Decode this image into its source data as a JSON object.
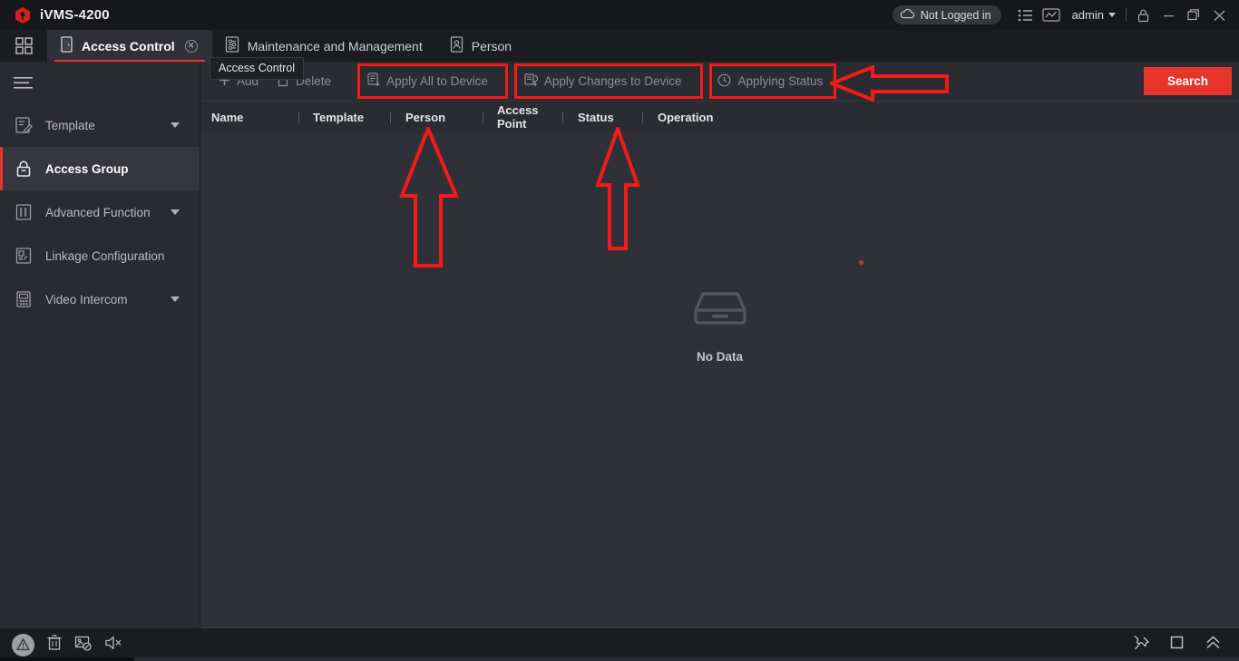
{
  "window": {
    "app_title": "iVMS-4200",
    "logo_icon": "hik-shield-icon",
    "login_status": "Not Logged in",
    "login_status_icon": "cloud-icon",
    "list_icon": "list-icon",
    "chart_icon": "chart-icon",
    "user_name": "admin",
    "user_caret_icon": "chevron-down-icon",
    "lock_icon": "lock-icon",
    "minimize_icon": "minimize-icon",
    "maximize_icon": "maximize-icon",
    "close_icon": "close-icon"
  },
  "tabbar": {
    "grid_icon": "grid-apps-icon",
    "tabs": [
      {
        "label": "Access Control",
        "icon": "door-icon",
        "active": true,
        "closable": true,
        "close_icon": "close-circle-icon"
      },
      {
        "label": "Maintenance and Management",
        "icon": "maintenance-icon",
        "active": false,
        "closable": false
      },
      {
        "label": "Person",
        "icon": "person-card-icon",
        "active": false,
        "closable": false
      }
    ]
  },
  "tooltip": {
    "text": "Access Control"
  },
  "sidebar": {
    "menu_icon": "hamburger-icon",
    "items": [
      {
        "label": "Template",
        "icon": "template-icon",
        "expandable": true,
        "active": false
      },
      {
        "label": "Access Group",
        "icon": "lock-group-icon",
        "expandable": false,
        "active": true
      },
      {
        "label": "Advanced Function",
        "icon": "advanced-function-icon",
        "expandable": true,
        "active": false
      },
      {
        "label": "Linkage Configuration",
        "icon": "linkage-icon",
        "expandable": false,
        "active": false
      },
      {
        "label": "Video Intercom",
        "icon": "video-intercom-icon",
        "expandable": true,
        "active": false
      }
    ]
  },
  "toolbar": {
    "buttons": [
      {
        "label": "Add",
        "icon": "plus-icon",
        "enabled": false
      },
      {
        "label": "Delete",
        "icon": "trash-icon",
        "enabled": false
      },
      {
        "label": "Apply All to Device",
        "icon": "apply-all-icon",
        "enabled": false
      },
      {
        "label": "Apply Changes to Device",
        "icon": "apply-changes-icon",
        "enabled": false
      },
      {
        "label": "Applying Status",
        "icon": "clock-status-icon",
        "enabled": false
      }
    ],
    "search_label": "Search"
  },
  "table": {
    "columns": [
      "Name",
      "Template",
      "Person",
      "Access Point",
      "Status",
      "Operation"
    ],
    "rows": [],
    "empty_state": {
      "label": "No Data",
      "icon": "empty-tray-icon"
    }
  },
  "statusbar": {
    "left_icons": [
      {
        "name": "alert-warning-icon"
      },
      {
        "name": "trash-icon"
      },
      {
        "name": "image-blocked-icon"
      },
      {
        "name": "speaker-muted-icon"
      }
    ],
    "right_icons": [
      {
        "name": "pin-icon"
      },
      {
        "name": "square-icon"
      },
      {
        "name": "chevron-double-up-icon"
      }
    ]
  },
  "annotations": {
    "color": "#f21b18",
    "highlight_boxes": [
      "Apply All to Device",
      "Apply Changes to Device",
      "Applying Status"
    ],
    "arrows": [
      {
        "points_to": "Apply All to Device",
        "direction": "up"
      },
      {
        "points_to": "Apply Changes to Device",
        "direction": "up"
      },
      {
        "points_to": "Applying Status",
        "direction": "left"
      }
    ]
  }
}
